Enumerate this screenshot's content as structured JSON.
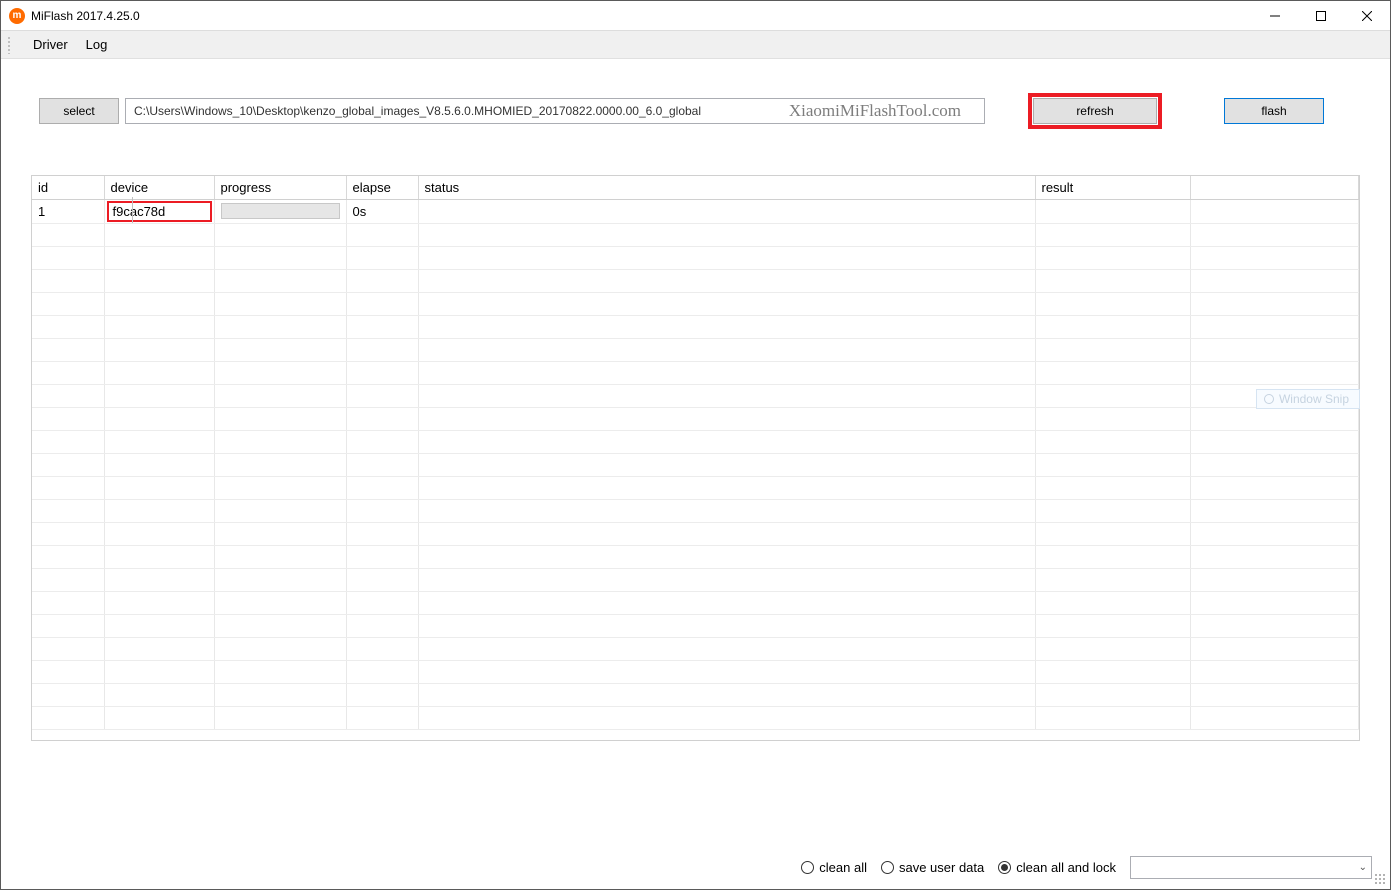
{
  "window": {
    "title": "MiFlash 2017.4.25.0"
  },
  "menu": {
    "items": [
      "Driver",
      "Log"
    ]
  },
  "toolbar": {
    "select_label": "select",
    "path_value": "C:\\Users\\Windows_10\\Desktop\\kenzo_global_images_V8.5.6.0.MHOMIED_20170822.0000.00_6.0_global",
    "watermark": "XiaomiMiFlashTool.com",
    "refresh_label": "refresh",
    "flash_label": "flash"
  },
  "table": {
    "headers": {
      "id": "id",
      "device": "device",
      "progress": "progress",
      "elapse": "elapse",
      "status": "status",
      "result": "result"
    },
    "rows": [
      {
        "id": "1",
        "device": "f9cac78d",
        "progress": "",
        "elapse": "0s",
        "status": "",
        "result": ""
      }
    ]
  },
  "footer": {
    "options": [
      {
        "label": "clean all",
        "checked": false
      },
      {
        "label": "save user data",
        "checked": false
      },
      {
        "label": "clean all and lock",
        "checked": true
      }
    ],
    "dropdown_value": ""
  },
  "overlay": {
    "snip_hint": "Window Snip"
  }
}
